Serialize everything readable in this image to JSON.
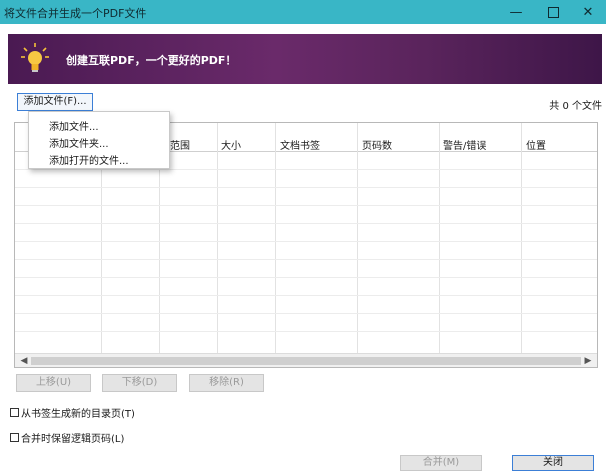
{
  "window": {
    "title": "将文件合并生成一个PDF文件",
    "minimize": "—",
    "close": "✕"
  },
  "banner": {
    "text": "创建互联PDF，一个更好的PDF！"
  },
  "toolbar": {
    "add_file_label": "添加文件(F)...",
    "file_count": "共 0 个文件"
  },
  "context_menu": {
    "items": [
      "添加文件...",
      "添加文件夹...",
      "添加打开的文件..."
    ]
  },
  "table": {
    "columns": [
      "页面范围",
      "大小",
      "文档书签",
      "页码数",
      "警告/错误",
      "位置"
    ],
    "header_partial": [
      "范围"
    ]
  },
  "actions": {
    "move_up": "上移(U)",
    "move_down": "下移(D)",
    "remove": "移除(R)"
  },
  "options": {
    "generate_toc": "从书签生成新的目录页(T)",
    "keep_page_labels": "合并时保留逻辑页码(L)"
  },
  "footer": {
    "merge": "合并(M)",
    "close": "关闭"
  },
  "colors": {
    "titlebar": "#39b6c6",
    "banner": "#5a245c",
    "focus_border": "#3c7fd6"
  }
}
